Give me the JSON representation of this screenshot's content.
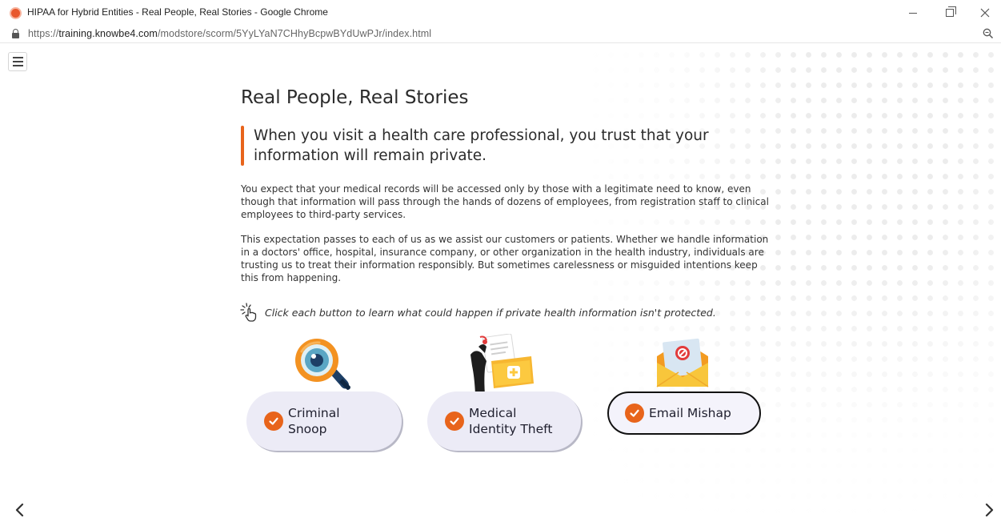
{
  "browser": {
    "window_title": "HIPAA for Hybrid Entities - Real People, Real Stories - Google Chrome",
    "url_scheme": "https://",
    "url_domain": "training.knowbe4.com",
    "url_path": "/modstore/scorm/5YyLYaN7CHhyBcpwBYdUwPJr/index.html"
  },
  "content": {
    "heading": "Real People, Real Stories",
    "quote": "When you visit a health care professional, you trust that your information will remain private.",
    "paragraph1": "You expect that your medical records will be accessed only by those with a legitimate need to know, even though that information will pass through the hands of dozens of employees, from registration staff to clinical employees to third-party services.",
    "paragraph2": "This expectation passes to each of us as we assist our customers or patients. Whether we handle information in a doctors' office, hospital, insurance company, or other organization in the health industry, individuals are trusting us to treat their information responsibly. But sometimes carelessness or misguided intentions keep this from happening.",
    "instruction": "Click each button to learn what could happen if private health information isn't protected."
  },
  "topics": [
    {
      "label_line1": "Criminal",
      "label_line2": "Snoop",
      "completed": true
    },
    {
      "label_line1": "Medical",
      "label_line2": "Identity Theft",
      "completed": true
    },
    {
      "label_line1": "Email Mishap",
      "label_line2": "",
      "completed": true,
      "selected": true
    }
  ],
  "colors": {
    "accent": "#e8641b",
    "button_bg": "#ecebf6",
    "text": "#2b2b2b"
  },
  "icons": {
    "menu": "hamburger-menu-icon",
    "prev": "chevron-left-icon",
    "next": "chevron-right-icon",
    "instruction": "click-hand-icon",
    "check": "checkmark-icon"
  }
}
